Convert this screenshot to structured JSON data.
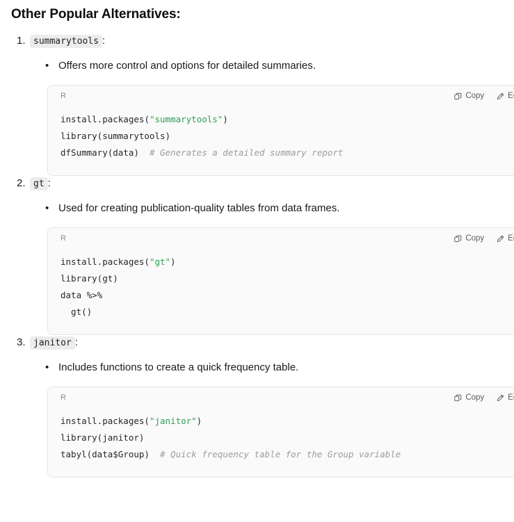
{
  "heading": "Other Popular Alternatives:",
  "code_ui": {
    "lang_label": "R",
    "copy_label": "Copy",
    "edit_label": "Edit",
    "copy_icon": "copy-icon",
    "edit_icon": "edit-pencil-icon"
  },
  "colors": {
    "string_green": "#2f9e52",
    "comment_gray": "#9c9c9c",
    "code_bg": "#fafafa",
    "code_border": "#e6e6e6",
    "inline_chip_bg": "#ececec"
  },
  "items": [
    {
      "number": "1.",
      "name": "summarytools",
      "colon": ":",
      "bullet_glyph": "•",
      "description": "Offers more control and options for detailed summaries.",
      "code": {
        "lines": [
          {
            "segments": [
              {
                "t": "install.packages(",
                "k": "pun"
              },
              {
                "t": "\"summarytools\"",
                "k": "str"
              },
              {
                "t": ")",
                "k": "pun"
              }
            ]
          },
          {
            "segments": [
              {
                "t": "library(summarytools)",
                "k": "pun"
              }
            ]
          },
          {
            "segments": [
              {
                "t": "dfSummary(data)  ",
                "k": "pun"
              },
              {
                "t": "# Generates a detailed summary report",
                "k": "com"
              }
            ]
          }
        ]
      }
    },
    {
      "number": "2.",
      "name": "gt",
      "colon": ":",
      "bullet_glyph": "•",
      "description": "Used for creating publication-quality tables from data frames.",
      "code": {
        "lines": [
          {
            "segments": [
              {
                "t": "install.packages(",
                "k": "pun"
              },
              {
                "t": "\"gt\"",
                "k": "str"
              },
              {
                "t": ")",
                "k": "pun"
              }
            ]
          },
          {
            "segments": [
              {
                "t": "library(gt)",
                "k": "pun"
              }
            ]
          },
          {
            "segments": [
              {
                "t": "data %>%",
                "k": "pun"
              }
            ]
          },
          {
            "segments": [
              {
                "t": "  gt()",
                "k": "pun"
              }
            ]
          }
        ]
      }
    },
    {
      "number": "3.",
      "name": "janitor",
      "colon": ":",
      "bullet_glyph": "•",
      "description": "Includes functions to create a quick frequency table.",
      "code": {
        "lines": [
          {
            "segments": [
              {
                "t": "install.packages(",
                "k": "pun"
              },
              {
                "t": "\"janitor\"",
                "k": "str"
              },
              {
                "t": ")",
                "k": "pun"
              }
            ]
          },
          {
            "segments": [
              {
                "t": "library(janitor)",
                "k": "pun"
              }
            ]
          },
          {
            "segments": [
              {
                "t": "tabyl(data$Group)  ",
                "k": "pun"
              },
              {
                "t": "# Quick frequency table for the Group variable",
                "k": "com"
              }
            ]
          }
        ]
      }
    }
  ]
}
